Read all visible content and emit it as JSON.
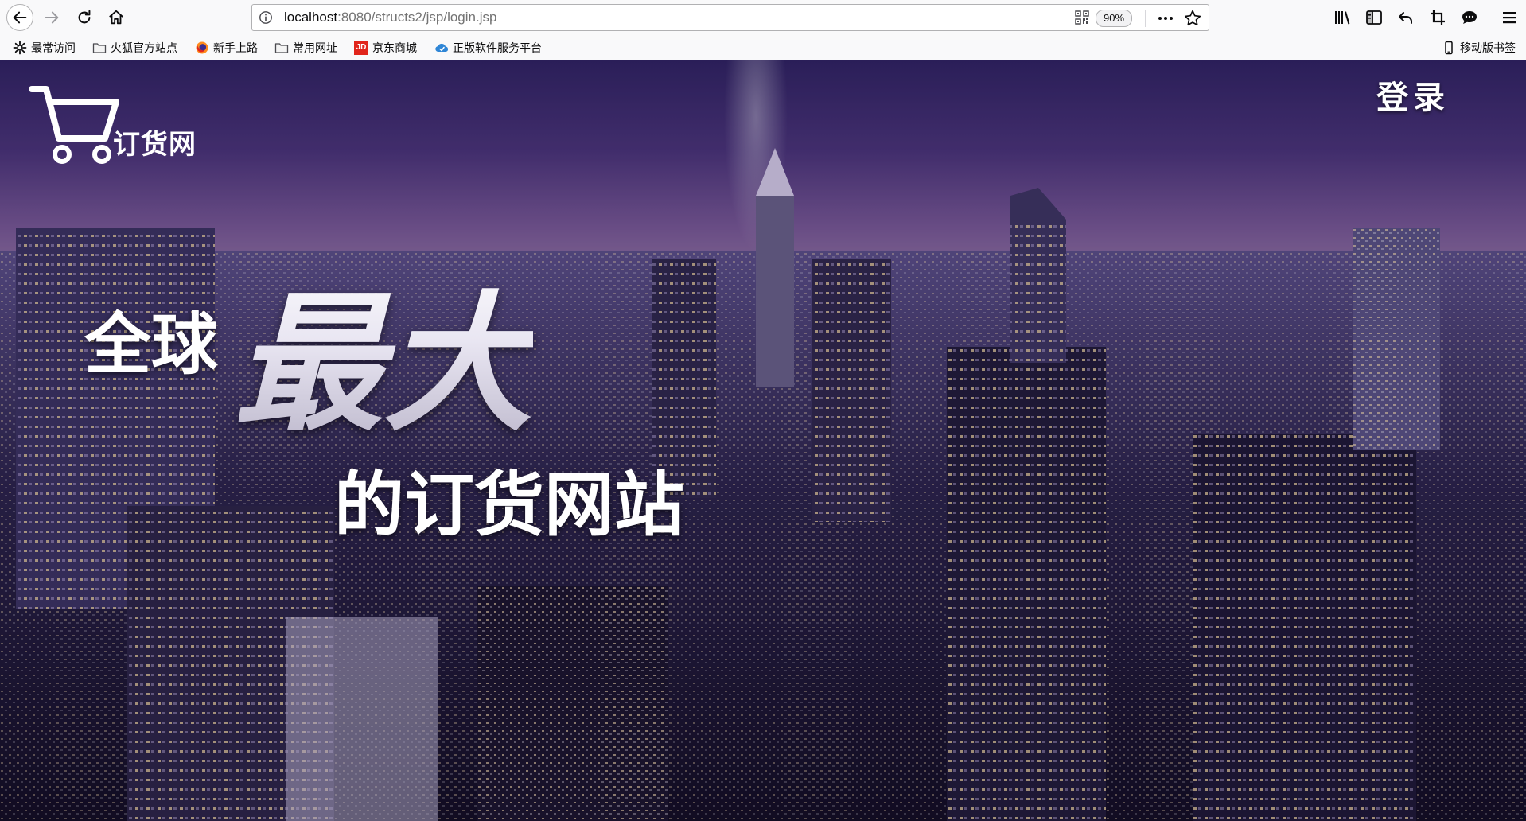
{
  "browser": {
    "url_host": "localhost",
    "url_path": ":8080/structs2/jsp/login.jsp",
    "zoom": "90%",
    "bookmarks": [
      {
        "label": "最常访问",
        "icon": "gear-icon"
      },
      {
        "label": "火狐官方站点",
        "icon": "folder-icon"
      },
      {
        "label": "新手上路",
        "icon": "firefox-icon"
      },
      {
        "label": "常用网址",
        "icon": "folder-icon"
      },
      {
        "label": "京东商城",
        "icon": "jd-icon",
        "icon_text": "JD"
      },
      {
        "label": "正版软件服务平台",
        "icon": "cloud-icon"
      }
    ],
    "mobile_bookmarks": "移动版书签",
    "colors": {
      "chrome_bg": "#f9f9fa",
      "border": "#b1b1b3",
      "jd_red": "#e1251b"
    }
  },
  "site": {
    "logo_text": "订货网",
    "login_label": "登录",
    "slogan_part1": "全球",
    "slogan_part2": "最大",
    "slogan_part3": "的订货网站"
  }
}
